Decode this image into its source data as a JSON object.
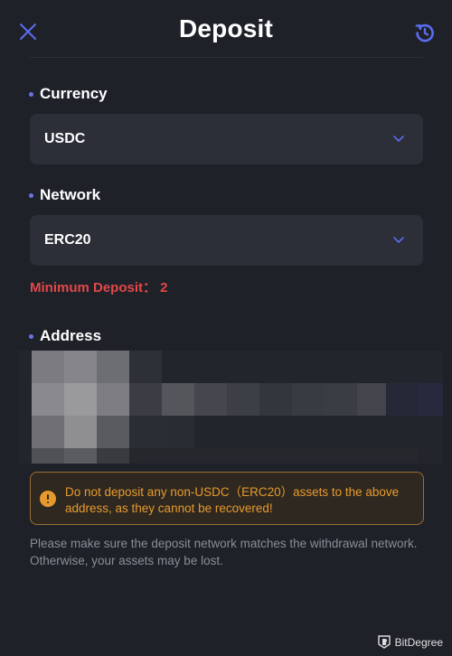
{
  "header": {
    "title": "Deposit",
    "close_icon": "close-icon",
    "history_icon": "history-icon"
  },
  "currency": {
    "label": "Currency",
    "value": "USDC"
  },
  "network": {
    "label": "Network",
    "value": "ERC20"
  },
  "minimum_deposit": "Minimum Deposit： 2",
  "address": {
    "label": "Address"
  },
  "warning": {
    "text": "Do not deposit any non-USDC（ERC20）assets to the above address, as they cannot be recovered!"
  },
  "note": "Please make sure the deposit network matches the withdrawal network. Otherwise, your assets may be lost.",
  "watermark": "BitDegree",
  "colors": {
    "background": "#1f2129",
    "field": "#2c2e38",
    "accent": "#5b6cf0",
    "error": "#e34848",
    "warning": "#e69a2e"
  }
}
